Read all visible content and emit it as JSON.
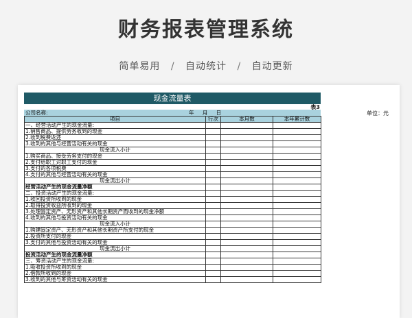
{
  "page": {
    "title": "财务报表管理系统",
    "features": [
      "简单易用",
      "自动统计",
      "自动更新"
    ],
    "separator": "/"
  },
  "sheet": {
    "banner": "现金流量表",
    "table_no": "表3",
    "company_label": "公司名称:",
    "date_label": "年 月 日",
    "unit": "单位：元",
    "columns": [
      "项目",
      "行次",
      "本月数",
      "本年累计数"
    ],
    "rows": [
      {
        "label": "一、经营活动产生的现金流量:",
        "style": "normal"
      },
      {
        "label": "1.销售商品、提供劳务收到的现金",
        "style": "normal"
      },
      {
        "label": "2.收到税费返还",
        "style": "normal"
      },
      {
        "label": "3.收到的其他与经营活动有关的现金",
        "style": "normal"
      },
      {
        "label": "现金流入小计",
        "style": "center"
      },
      {
        "label": "1.购买商品、接受劳务支付的现金",
        "style": "normal"
      },
      {
        "label": "2.支付给职工对职工支付的现金",
        "style": "normal"
      },
      {
        "label": "3.支付的各项税费",
        "style": "normal"
      },
      {
        "label": "4.支付的其他与经营活动有关的现金",
        "style": "normal"
      },
      {
        "label": "现金流出小计",
        "style": "center"
      },
      {
        "label": "经营活动产生的现金流量净额",
        "style": "bold"
      },
      {
        "label": "二、投资活动产生的现金流量:",
        "style": "normal"
      },
      {
        "label": "1.收回投资所收到的现金",
        "style": "normal"
      },
      {
        "label": "2.取得投资收益所收到的现金",
        "style": "normal"
      },
      {
        "label": "3.处理固定资产、无形资产和其他长期资产而收到的现金净额",
        "style": "normal"
      },
      {
        "label": "4.收到的其他与投资活动有关的现金",
        "style": "normal"
      },
      {
        "label": "现金流入小计",
        "style": "center"
      },
      {
        "label": "1.购建固定资产、无形资产和其他长期资产所支付的现金",
        "style": "normal"
      },
      {
        "label": "2.投资所支付的现金",
        "style": "normal"
      },
      {
        "label": "3.支付的其他与投资活动有关的现金",
        "style": "normal"
      },
      {
        "label": "现金流出小计",
        "style": "center"
      },
      {
        "label": "投资活动产生的现金流量净额",
        "style": "bold"
      },
      {
        "label": "三、筹资活动产生的现金流量:",
        "style": "normal"
      },
      {
        "label": "1.吸收投资所收到的现金",
        "style": "normal"
      },
      {
        "label": "2.借款所收到的现金",
        "style": "normal"
      },
      {
        "label": "3.收到的其他与筹资活动有关的现金",
        "style": "normal"
      }
    ]
  }
}
